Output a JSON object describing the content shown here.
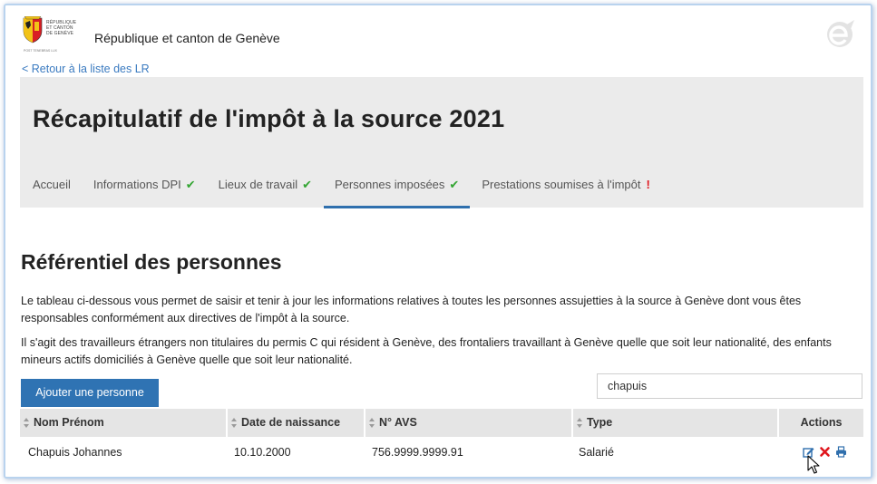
{
  "header": {
    "logo_text": [
      "RÉPUBLIQUE",
      "ET CANTON",
      "DE GENÈVE"
    ],
    "logo_sub": "POST TENEBRAS LUX",
    "site_title": "République et canton de Genève"
  },
  "back_link": "< Retour à la liste des LR",
  "page_title": "Récapitulatif de l'impôt à la source 2021",
  "tabs": [
    {
      "label": "Accueil",
      "status": "",
      "active": false
    },
    {
      "label": "Informations DPI",
      "status": "✔",
      "active": false
    },
    {
      "label": "Lieux de travail",
      "status": "✔",
      "active": false
    },
    {
      "label": "Personnes imposées",
      "status": "✔",
      "active": true
    },
    {
      "label": "Prestations soumises à l'impôt",
      "status": "!",
      "active": false
    }
  ],
  "section_title": "Référentiel des personnes",
  "paragraphs": [
    "Le tableau ci-dessous vous permet de saisir et tenir à jour les informations relatives à toutes les personnes assujetties à la source à Genève dont vous êtes responsables conformément aux directives de l'impôt à la source.",
    "Il s'agit des travailleurs étrangers non titulaires du permis C qui résident à Genève, des frontaliers travaillant à Genève quelle que soit leur nationalité, des enfants mineurs actifs domiciliés à Genève quelle que soit leur nationalité."
  ],
  "add_button": "Ajouter une personne",
  "search": {
    "value": "chapuis",
    "placeholder": ""
  },
  "table": {
    "headers": [
      "Nom Prénom",
      "Date de naissance",
      "N° AVS",
      "Type",
      "Actions"
    ],
    "rows": [
      {
        "name": "Chapuis Johannes",
        "birth": "10.10.2000",
        "avs": "756.9999.9999.91",
        "type": "Salarié"
      }
    ]
  },
  "colors": {
    "accent": "#2f73b3",
    "link": "#3a7ac0",
    "panel": "#ebebeb",
    "check": "#33a532",
    "alert": "#e0161d"
  },
  "icons": [
    "geneva-coat-of-arms-icon",
    "e-logo-icon",
    "check-icon",
    "exclamation-icon",
    "sort-icon",
    "edit-icon",
    "delete-icon",
    "print-icon",
    "mouse-cursor-icon"
  ]
}
